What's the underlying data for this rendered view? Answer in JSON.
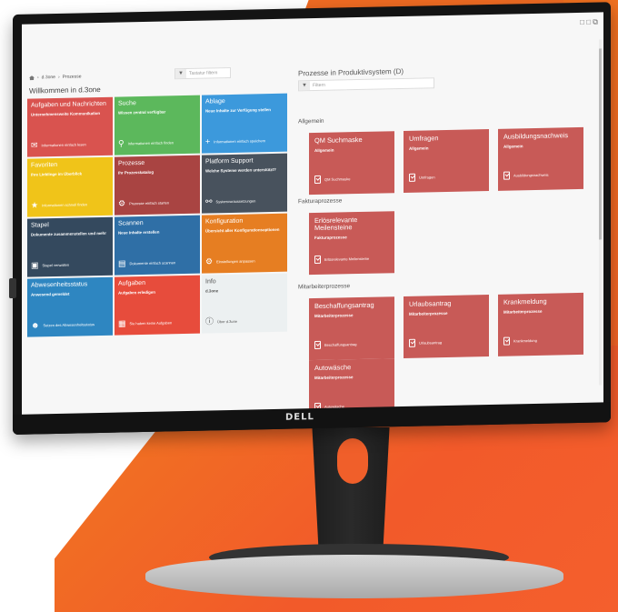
{
  "monitor": {
    "brand": "DELL"
  },
  "window": {
    "controls": "□ □ ⧉"
  },
  "breadcrumb": {
    "items": [
      "d.3one",
      "Prozesse"
    ]
  },
  "left": {
    "welcome": "Willkommen in d.3one",
    "filter_placeholder": "Tastatur filtern",
    "tiles": [
      {
        "title": "Aufgaben und Nachrichten",
        "sub": "Unternehmensweite Kommunikation",
        "row": "Informationen einfach lesen",
        "icon": "mail-icon",
        "color": "#d9534f"
      },
      {
        "title": "Suche",
        "sub": "Wissen zentral verfügbar",
        "row": "Informationen einfach finden",
        "icon": "search-icon",
        "color": "#5cb85c"
      },
      {
        "title": "Ablage",
        "sub": "Neue Inhalte zur Verfügung stellen",
        "row": "Informationen einfach speichern",
        "icon": "plus-icon",
        "color": "#3c99dc"
      },
      {
        "title": "Favoriten",
        "sub": "Ihre Lieblinge im Überblick",
        "row": "Informationen schnell finden",
        "icon": "star-icon",
        "color": "#f0c419"
      },
      {
        "title": "Prozesse",
        "sub": "Ihr Prozesskatalog",
        "row": "Prozesse einfach starten",
        "icon": "process-icon",
        "color": "#a94442"
      },
      {
        "title": "Platform Support",
        "sub": "Welche Systeme werden unterstützt?",
        "row": "Systemvoraussetzungen",
        "icon": "link-icon",
        "color": "#48525d"
      },
      {
        "title": "Stapel",
        "sub": "Dokumente zusammenstellen und mehr",
        "row": "Stapel verwalten",
        "icon": "stack-icon",
        "color": "#34495e"
      },
      {
        "title": "Scannen",
        "sub": "Neue Inhalte erstellen",
        "row": "Dokumente einfach scannen",
        "icon": "scan-icon",
        "color": "#2f6fa6"
      },
      {
        "title": "Konfiguration",
        "sub": "Übersicht aller Konfigurationsoptionen",
        "row": "Einstellungen anpassen",
        "icon": "gear-icon",
        "color": "#e67e22"
      },
      {
        "title": "Abwesenheitsstatus",
        "sub": "Anwesend gemeldet",
        "row": "Setzen des Abwesenheitsstatus",
        "icon": "person-icon",
        "color": "#2e86c1"
      },
      {
        "title": "Aufgaben",
        "sub": "Aufgaben erledigen",
        "row": "Sie haben keine Aufgaben",
        "icon": "clipboard-icon",
        "color": "#e74c3c"
      },
      {
        "title": "Info",
        "sub": "d.3one",
        "row": "Über d.3one",
        "icon": "info-icon",
        "color": "#ecf0f1"
      }
    ]
  },
  "right": {
    "title": "Prozesse in Produktivsystem (D)",
    "filter_placeholder": "Filtern",
    "sections": [
      {
        "label": "Allgemein",
        "tiles": [
          {
            "title": "QM Suchmaske",
            "cat": "Allgemein",
            "row": "QM Suchmaske"
          },
          {
            "title": "Umfragen",
            "cat": "Allgemein",
            "row": "Umfragen"
          },
          {
            "title": "Ausbildungsnachweis",
            "cat": "Allgemein",
            "row": "Ausbildungsnachweis"
          }
        ]
      },
      {
        "label": "Fakturaprozesse",
        "tiles": [
          {
            "title": "Erlösrelevante Meilensteine",
            "cat": "Fakturaprozesse",
            "row": "Erlösrelevante Meilensteine"
          }
        ]
      },
      {
        "label": "Mitarbeiterprozesse",
        "tiles": [
          {
            "title": "Beschaffungsantrag",
            "cat": "Mitarbeiterprozesse",
            "row": "Beschaffungsantrag"
          },
          {
            "title": "Urlaubsantrag",
            "cat": "Mitarbeiterprozesse",
            "row": "Urlaubsantrag"
          },
          {
            "title": "Krankmeldung",
            "cat": "Mitarbeiterprozesse",
            "row": "Krankmeldung"
          },
          {
            "title": "Autowäsche",
            "cat": "Mitarbeiterprozesse",
            "row": "Autowäsche"
          }
        ]
      }
    ]
  }
}
